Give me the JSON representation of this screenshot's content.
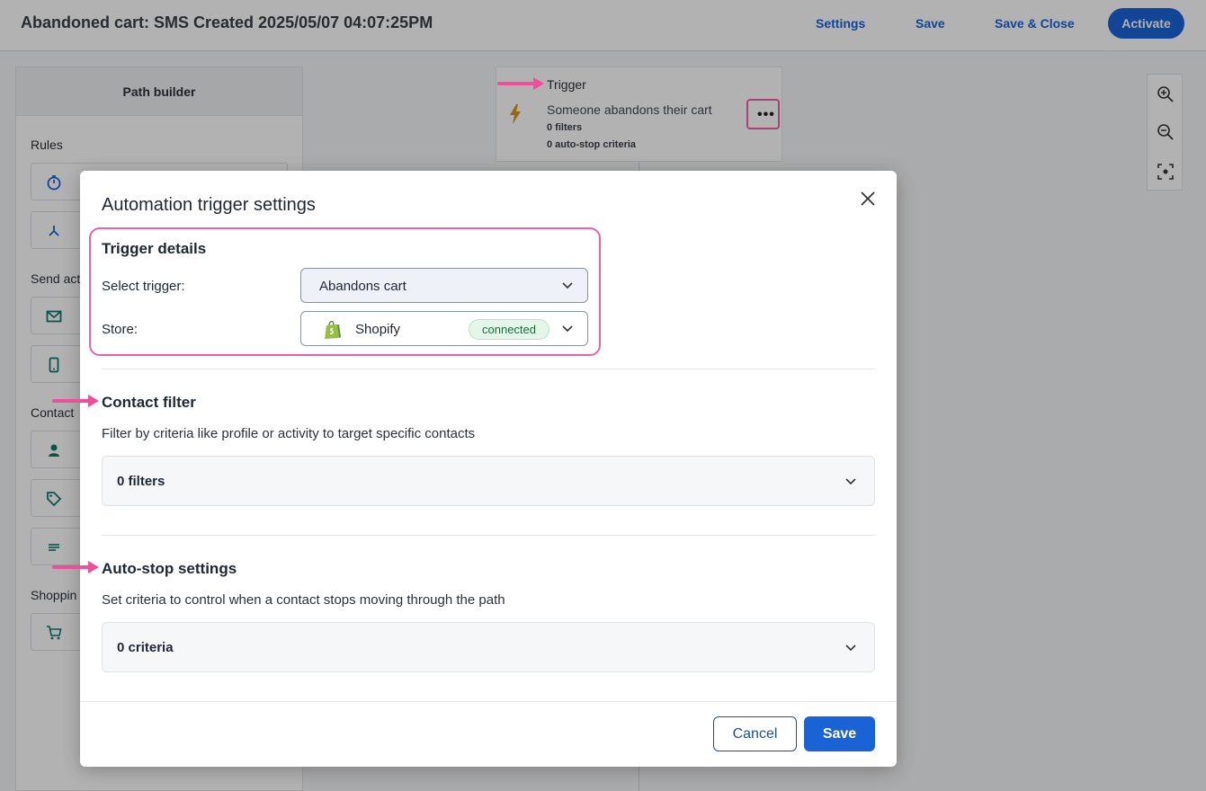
{
  "header": {
    "title": "Abandoned cart: SMS Created 2025/05/07 04:07:25PM",
    "settings_label": "Settings",
    "save_label": "Save",
    "save_close_label": "Save & Close",
    "activate_label": "Activate"
  },
  "path_builder": {
    "title": "Path builder",
    "sections": {
      "rules": "Rules",
      "send_actions": "Send act",
      "contact": "Contact",
      "shopping": "Shoppin"
    },
    "tiles": [
      {
        "icon": "stopwatch-icon"
      },
      {
        "icon": "branch-icon"
      },
      {
        "icon": "envelope-icon"
      },
      {
        "icon": "mobile-phone-icon"
      },
      {
        "icon": "person-icon"
      },
      {
        "icon": "tag-icon"
      },
      {
        "icon": "list-lines-icon"
      },
      {
        "icon": "shopping-cart-icon"
      }
    ]
  },
  "trigger_card": {
    "title": "Trigger",
    "subtitle": "Someone abandons their cart",
    "filters": "0 filters",
    "auto_stop": "0 auto-stop criteria",
    "more_icon": "•••"
  },
  "modal": {
    "title": "Automation trigger settings",
    "trigger_details": {
      "heading": "Trigger details",
      "select_trigger_label": "Select trigger:",
      "select_trigger_value": "Abandons cart",
      "store_label": "Store:",
      "store_value": "Shopify",
      "store_status": "connected"
    },
    "contact_filter": {
      "heading": "Contact filter",
      "description": "Filter by criteria like profile or activity to target specific contacts",
      "value": "0 filters"
    },
    "auto_stop": {
      "heading": "Auto-stop settings",
      "description": "Set criteria to control when a contact stops moving through the path",
      "value": "0 criteria"
    },
    "cancel_label": "Cancel",
    "save_label": "Save"
  },
  "colors": {
    "accent": "#1a63d6",
    "highlight": "#ef5fa4",
    "connected_bg": "#e4f6ea"
  }
}
